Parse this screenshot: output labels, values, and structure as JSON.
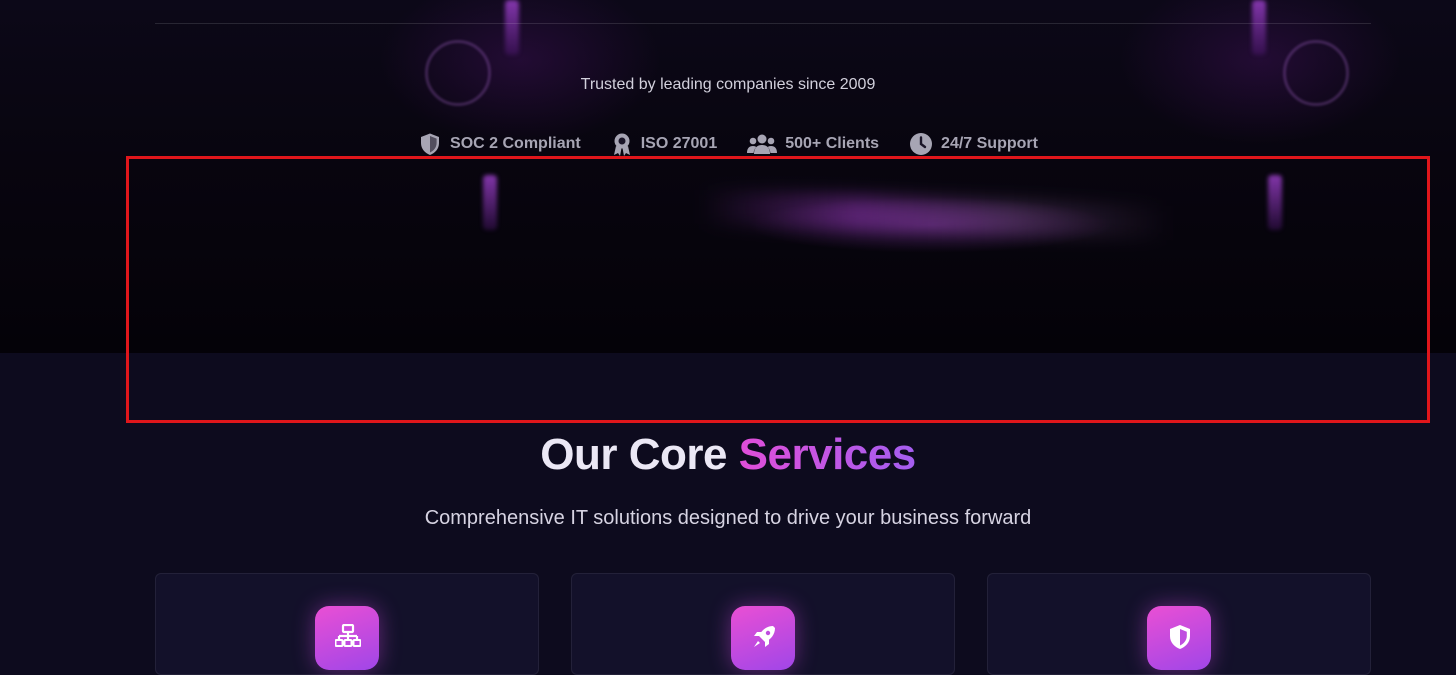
{
  "hero": {
    "trusted_text": "Trusted by leading companies since 2009",
    "badges": [
      {
        "icon": "shield-icon",
        "label": "SOC 2 Compliant"
      },
      {
        "icon": "award-icon",
        "label": "ISO 27001"
      },
      {
        "icon": "users-icon",
        "label": "500+ Clients"
      },
      {
        "icon": "clock-icon",
        "label": "24/7 Support"
      }
    ]
  },
  "services": {
    "title_main": "Our Core ",
    "title_accent": "Services",
    "subtitle": "Comprehensive IT solutions designed to drive your business forward",
    "cards": [
      {
        "icon": "network-icon"
      },
      {
        "icon": "rocket-icon"
      },
      {
        "icon": "shield-icon"
      }
    ]
  },
  "colors": {
    "accent_start": "#e04ed8",
    "accent_end": "#a45ef0",
    "background": "#0d0b1e",
    "highlight_border": "#e0161b"
  }
}
